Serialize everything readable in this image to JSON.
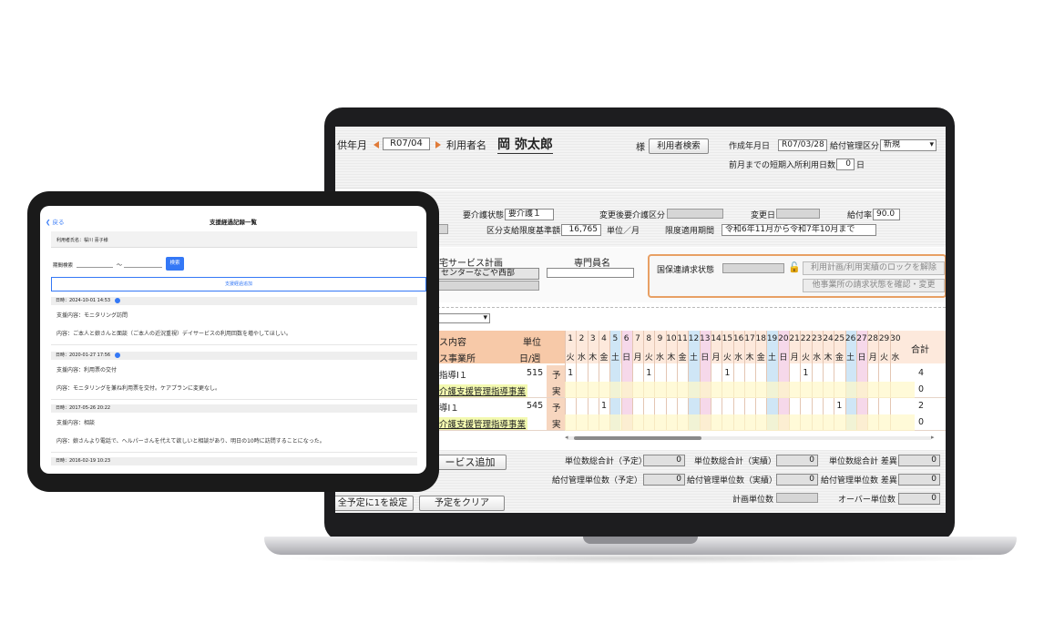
{
  "laptop": {
    "header": {
      "service_month_label": "供年月",
      "service_month_value": "R07/04",
      "user_name_label": "利用者名",
      "user_name": "岡 弥太郎",
      "honorific": "様",
      "user_search_button": "利用者検索",
      "created_date_label": "作成年月日",
      "created_date_value": "R07/03/28",
      "benefit_mgmt_label": "給付管理区分",
      "benefit_mgmt_value": "新規",
      "short_stay_label": "前月までの短期入所利用日数",
      "short_stay_days": "0",
      "short_stay_unit": "日"
    },
    "info": {
      "care_level_label": "要介護状態",
      "care_level_value": "要介護１",
      "changed_care_level_label": "変更後要介護区分",
      "change_date_label": "変更日",
      "benefit_rate_label": "給付率",
      "benefit_rate_value": "90.0",
      "limit_base_label": "区分支給限度基準額",
      "limit_base_value": "16,765",
      "limit_unit": "単位／月",
      "limit_period_label": "限度適用期間",
      "limit_period_value": "令和6年11月から令和7年10月まで"
    },
    "middle": {
      "plan_label": "宅サービス計画",
      "plan_value": "センターなごや西部",
      "specialist_label": "専門員名",
      "national_claim_label": "国保連請求状態",
      "lock_button": "利用計画/利用実績のロックを解除",
      "other_claim_button": "他事業所の請求状態を確認・変更"
    },
    "table": {
      "header_content": "ス内容",
      "header_office": "ス事業所",
      "header_unit": "単位",
      "header_per_week": "日/週",
      "header_total": "合計",
      "days": [
        "1",
        "2",
        "3",
        "4",
        "5",
        "6",
        "7",
        "8",
        "9",
        "10",
        "11",
        "12",
        "13",
        "14",
        "15",
        "16",
        "17",
        "18",
        "19",
        "20",
        "21",
        "22",
        "23",
        "24",
        "25",
        "26",
        "27",
        "28",
        "29",
        "30"
      ],
      "weekdays": [
        "火",
        "水",
        "木",
        "金",
        "土",
        "日",
        "月",
        "火",
        "水",
        "木",
        "金",
        "土",
        "日",
        "月",
        "火",
        "水",
        "木",
        "金",
        "土",
        "日",
        "月",
        "火",
        "水",
        "木",
        "金",
        "土",
        "日",
        "月",
        "火",
        "水"
      ],
      "rows": [
        {
          "service": "指導Ⅰ１",
          "office": "介護支援管理指導事業",
          "units": "515",
          "plan_label": "予",
          "actual_label": "実",
          "plan_days": [
            "1",
            "",
            "",
            "",
            "",
            "",
            "",
            "1",
            "",
            "",
            "",
            "",
            "",
            "",
            "1",
            "",
            "",
            "",
            "",
            "",
            "",
            "1",
            "",
            "",
            "",
            "",
            "",
            "",
            "",
            ""
          ],
          "plan_total": "4",
          "actual_total": "0"
        },
        {
          "service": "導Ⅰ１",
          "office": "介護支援管理指導事業",
          "units": "545",
          "plan_label": "予",
          "actual_label": "実",
          "plan_days": [
            "",
            "",
            "",
            "1",
            "",
            "",
            "",
            "",
            "",
            "",
            "",
            "",
            "",
            "",
            "",
            "",
            "",
            "",
            "",
            "",
            "",
            "",
            "",
            "",
            "1",
            "",
            "",
            "",
            "",
            ""
          ],
          "plan_total": "2",
          "actual_total": "0"
        }
      ]
    },
    "footer": {
      "add_service_button": "ービス追加",
      "set_all_button": "全予定に1を設定",
      "clear_button": "予定をクリア",
      "unit_total_plan_label": "単位数総合計（予定）",
      "unit_total_plan": "0",
      "unit_total_actual_label": "単位数総合計（実績）",
      "unit_total_actual": "0",
      "unit_total_diff_label": "単位数総合計 差異",
      "unit_total_diff": "0",
      "benefit_units_plan_label": "給付管理単位数（予定）",
      "benefit_units_plan": "0",
      "benefit_units_actual_label": "給付管理単位数（実績）",
      "benefit_units_actual": "0",
      "benefit_units_diff_label": "給付管理単位数 差異",
      "benefit_units_diff": "0",
      "plan_units_label": "計画単位数",
      "over_units_label": "オーバー単位数",
      "over_units": "0"
    }
  },
  "tablet": {
    "back_label": "戻る",
    "title": "支援経過記録一覧",
    "user_label": "利用者氏名：桜川 喜子様",
    "period_label": "期間検索",
    "period_sep": "〜",
    "search_button": "検索",
    "add_button": "支援経過追加",
    "records": [
      {
        "datetime": "日時：2024-10-01 14:53",
        "support": "支援内容：モニタリング訪問",
        "content": "内容：ご本人と娘さんと面談（ご本人の近況重視）デイサービスの利用回数を増やしてほしい。",
        "attachment": true
      },
      {
        "datetime": "日時：2020-01-27 17:56",
        "support": "支援内容：利用票の交付",
        "content": "内容：モニタリングを兼ね利用票を交付。ケアプランに変更なし。",
        "attachment": true
      },
      {
        "datetime": "日時：2017-05-26 20:22",
        "support": "支援内容：相談",
        "content": "内容：娘さんより電話で、ヘルパーさんを代えて欲しいと相談があり、明日の10時に訪問することになった。",
        "attachment": false
      },
      {
        "datetime": "日時：2016-02-19 10:23",
        "support": "",
        "content": "",
        "attachment": false
      }
    ]
  },
  "colors": {
    "accent_orange": "#e8a064",
    "tablet_blue": "#3478f6",
    "saturday": "#cfe6f6",
    "sunday": "#f6d8ea"
  }
}
